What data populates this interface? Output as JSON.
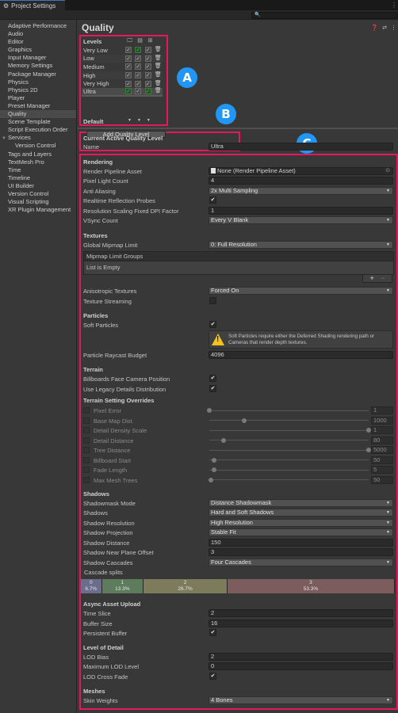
{
  "window": {
    "tab_title": "Project Settings",
    "search_placeholder": ""
  },
  "sidebar": {
    "items": [
      {
        "label": "Adaptive Performance"
      },
      {
        "label": "Audio"
      },
      {
        "label": "Editor"
      },
      {
        "label": "Graphics"
      },
      {
        "label": "Input Manager"
      },
      {
        "label": "Memory Settings"
      },
      {
        "label": "Package Manager"
      },
      {
        "label": "Physics"
      },
      {
        "label": "Physics 2D"
      },
      {
        "label": "Player"
      },
      {
        "label": "Preset Manager"
      },
      {
        "label": "Quality",
        "selected": true
      },
      {
        "label": "Scene Template"
      },
      {
        "label": "Script Execution Order"
      },
      {
        "label": "Services",
        "expanded": true
      },
      {
        "label": "Version Control",
        "child": true
      },
      {
        "label": "Tags and Layers"
      },
      {
        "label": "TextMesh Pro"
      },
      {
        "label": "Time"
      },
      {
        "label": "Timeline"
      },
      {
        "label": "UI Builder"
      },
      {
        "label": "Version Control"
      },
      {
        "label": "Visual Scripting"
      },
      {
        "label": "XR Plugin Management"
      }
    ]
  },
  "page": {
    "title": "Quality",
    "header_icons": [
      "help-icon",
      "preset-icon",
      "more-icon"
    ]
  },
  "annotations": {
    "a": "A",
    "b": "B",
    "c": "C",
    "box_color": "#e6175c",
    "badge_color": "#2196f3"
  },
  "levels": {
    "header": "Levels",
    "platforms": [
      "standalone-icon",
      "webgl-icon",
      "windows-icon"
    ],
    "rows": [
      {
        "name": "Very Low",
        "checks": [
          true,
          true,
          true
        ],
        "default_for": [
          false,
          true,
          false
        ]
      },
      {
        "name": "Low",
        "checks": [
          true,
          true,
          true
        ],
        "default_for": [
          false,
          false,
          false
        ]
      },
      {
        "name": "Medium",
        "checks": [
          true,
          true,
          true
        ],
        "default_for": [
          false,
          false,
          false
        ]
      },
      {
        "name": "High",
        "checks": [
          true,
          true,
          true
        ],
        "default_for": [
          false,
          false,
          false
        ]
      },
      {
        "name": "Very High",
        "checks": [
          true,
          true,
          true
        ],
        "default_for": [
          false,
          false,
          false
        ]
      },
      {
        "name": "Ultra",
        "checks": [
          true,
          true,
          true
        ],
        "default_for": [
          true,
          false,
          true
        ],
        "selected": true
      }
    ],
    "default_label": "Default",
    "add_button": "Add Quality Level"
  },
  "current": {
    "title": "Current Active Quality Level",
    "name_label": "Name",
    "name_value": "Ultra"
  },
  "rendering": {
    "title": "Rendering",
    "render_pipeline_label": "Render Pipeline Asset",
    "render_pipeline_value": "None (Render Pipeline Asset)",
    "pixel_light_label": "Pixel Light Count",
    "pixel_light_value": "4",
    "anti_aliasing_label": "Anti Aliasing",
    "anti_aliasing_value": "2x Multi Sampling",
    "realtime_probes_label": "Realtime Reflection Probes",
    "realtime_probes_value": true,
    "dpi_label": "Resolution Scaling Fixed DPI Factor",
    "dpi_value": "1",
    "vsync_label": "VSync Count",
    "vsync_value": "Every V Blank"
  },
  "textures": {
    "title": "Textures",
    "mipmap_limit_label": "Global Mipmap Limit",
    "mipmap_limit_value": "0: Full Resolution",
    "groups_header": "Mipmap Limit Groups",
    "groups_empty": "List is Empty",
    "add": "+",
    "remove": "−",
    "aniso_label": "Anisotropic Textures",
    "aniso_value": "Forced On",
    "streaming_label": "Texture Streaming",
    "streaming_value": false
  },
  "particles": {
    "title": "Particles",
    "soft_label": "Soft Particles",
    "soft_value": true,
    "warning_line1": "Soft Particles require either the Deferred Shading rendering path or",
    "warning_line2": "Cameras that render depth textures.",
    "raycast_label": "Particle Raycast Budget",
    "raycast_value": "4096"
  },
  "terrain": {
    "title": "Terrain",
    "billboards_label": "Billboards Face Camera Position",
    "billboards_value": true,
    "legacy_label": "Use Legacy Details Distribution",
    "legacy_value": true,
    "overrides_title": "Terrain Setting Overrides",
    "overrides": [
      {
        "label": "Pixel Error",
        "value": "1",
        "fraction": 0.0
      },
      {
        "label": "Base Map Dist.",
        "value": "1000",
        "fraction": 0.22
      },
      {
        "label": "Detail Density Scale",
        "value": "1",
        "fraction": 1.0
      },
      {
        "label": "Detail Distance",
        "value": "80",
        "fraction": 0.09
      },
      {
        "label": "Tree Distance",
        "value": "5000",
        "fraction": 1.0
      },
      {
        "label": "Billboard Start",
        "value": "50",
        "fraction": 0.03
      },
      {
        "label": "Fade Length",
        "value": "5",
        "fraction": 0.03
      },
      {
        "label": "Max Mesh Trees",
        "value": "50",
        "fraction": 0.01
      }
    ]
  },
  "shadows": {
    "title": "Shadows",
    "mask_label": "Shadowmask Mode",
    "mask_value": "Distance Shadowmask",
    "shadows_label": "Shadows",
    "shadows_value": "Hard and Soft Shadows",
    "resolution_label": "Shadow Resolution",
    "resolution_value": "High Resolution",
    "projection_label": "Shadow Projection",
    "projection_value": "Stable Fit",
    "distance_label": "Shadow Distance",
    "distance_value": "150",
    "near_label": "Shadow Near Plane Offset",
    "near_value": "3",
    "cascades_label": "Shadow Cascades",
    "cascades_value": "Four Cascades",
    "splits_label": "Cascade splits",
    "splits": [
      {
        "index": "0",
        "percent": "6.7%",
        "share": 6.7,
        "color": "#6c6c8c"
      },
      {
        "index": "1",
        "percent": "13.3%",
        "share": 13.3,
        "color": "#5c7c5c"
      },
      {
        "index": "2",
        "percent": "26.7%",
        "share": 26.7,
        "color": "#7c7c5c"
      },
      {
        "index": "3",
        "percent": "53.3%",
        "share": 53.3,
        "color": "#7c5c5c"
      }
    ]
  },
  "async": {
    "title": "Async Asset Upload",
    "time_slice_label": "Time Slice",
    "time_slice_value": "2",
    "buffer_label": "Buffer Size",
    "buffer_value": "16",
    "persistent_label": "Persistent Buffer",
    "persistent_value": true
  },
  "lod": {
    "title": "Level of Detail",
    "bias_label": "LOD Bias",
    "bias_value": "2",
    "max_label": "Maximum LOD Level",
    "max_value": "0",
    "crossfade_label": "LOD Cross Fade",
    "crossfade_value": true
  },
  "meshes": {
    "title": "Meshes",
    "skin_label": "Skin Weights",
    "skin_value": "4 Bones"
  }
}
